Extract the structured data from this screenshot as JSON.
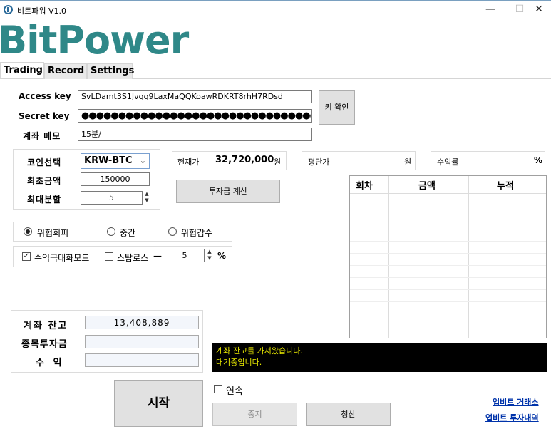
{
  "window": {
    "title": "비트파워 V1.0",
    "minimize": "—",
    "maximize": "☐",
    "close": "✕"
  },
  "brand": "BitPower",
  "tabs": [
    "Trading",
    "Record",
    "Settings"
  ],
  "credentials": {
    "access_key_label": "Access key",
    "access_key_value": "SvLDamt3S1Jvqq9LaxMaQQKoawRDKRT8rhH7RDsd",
    "secret_key_label": "Secret key",
    "secret_key_value": "●●●●●●●●●●●●●●●●●●●●●●●●●●●●●●●●●●●●●●●●",
    "memo_label": "계좌 메모",
    "memo_value": "15분/",
    "confirm_button": "키 확인"
  },
  "coin": {
    "select_label": "코인선택",
    "selected": "KRW-BTC",
    "initial_amount_label": "최초금액",
    "initial_amount": "150000",
    "max_split_label": "최대분할",
    "max_split": "5"
  },
  "price": {
    "current_label": "현재가",
    "current_value": "32,720,000",
    "current_unit": "원",
    "avg_label": "평단가",
    "avg_value": "",
    "avg_unit": "원",
    "return_label": "수익률",
    "return_value": "",
    "return_unit": "%"
  },
  "calc_button": "투자금 계산",
  "grid": {
    "columns": [
      "회차",
      "금액",
      "누적"
    ],
    "rows": []
  },
  "risk": {
    "options": [
      "위험회피",
      "중간",
      "위험감수"
    ],
    "selected_index": 0
  },
  "modes": {
    "maximize_label": "수익극대화모드",
    "maximize_checked": true,
    "stoploss_label": "스탑로스",
    "stoploss_checked": false,
    "stoploss_prefix": "—",
    "stoploss_value": "5",
    "stoploss_unit": "%"
  },
  "account": {
    "balance_label": "계좌 잔고",
    "balance_value": "13,408,889",
    "invest_label": "종목투자금",
    "invest_value": "",
    "profit_label": "수 익",
    "profit_value": ""
  },
  "log": {
    "lines": [
      "계좌 잔고를 가져왔습니다.",
      "대기중입니다."
    ]
  },
  "controls": {
    "start_button": "시작",
    "continuous_label": "연속",
    "continuous_checked": false,
    "stop_button": "중지",
    "liquidate_button": "청산"
  },
  "links": {
    "upbit_exchange": "업비트 거래소",
    "upbit_history": "업비트 투자내역"
  },
  "colors": {
    "brand": "#2f8888",
    "log_bg": "#000000",
    "log_text": "#e6e600",
    "link": "#0033aa"
  }
}
